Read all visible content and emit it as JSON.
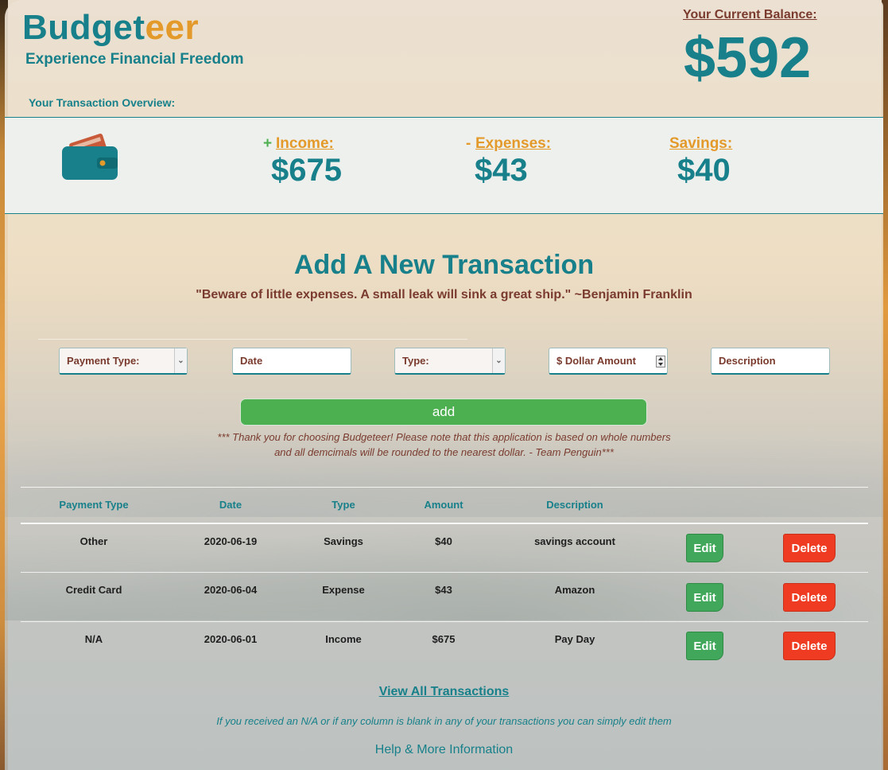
{
  "brand": {
    "name_main": "Budget",
    "name_accent": "eer",
    "tagline": "Experience Financial Freedom"
  },
  "balance": {
    "label": "Your Current Balance:",
    "value": "$592"
  },
  "overview": {
    "label": "Your Transaction Overview:",
    "income": {
      "prefix": "+",
      "label": "Income:",
      "value": "$675"
    },
    "expenses": {
      "prefix": "-",
      "label": "Expenses:",
      "value": "$43"
    },
    "savings": {
      "label": "Savings:",
      "value": "$40"
    }
  },
  "form": {
    "title": "Add A New Transaction",
    "quote": "\"Beware of little expenses. A small leak will sink a great ship.\" ~Benjamin Franklin",
    "payment_type": "Payment Type:",
    "date_placeholder": "Date",
    "type": "Type:",
    "amount_placeholder": "$ Dollar Amount",
    "description_placeholder": "Description",
    "add_label": "add",
    "note_line1": "*** Thank you for choosing Budgeteer! Please note that this application is based on whole numbers",
    "note_line2": "and all demcimals will be rounded to the nearest dollar. - Team Penguin***"
  },
  "table": {
    "headers": [
      "Payment Type",
      "Date",
      "Type",
      "Amount",
      "Description"
    ],
    "edit_label": "Edit",
    "delete_label": "Delete",
    "rows": [
      {
        "payment_type": "Other",
        "date": "2020-06-19",
        "type": "Savings",
        "amount": "$40",
        "description": "savings account"
      },
      {
        "payment_type": "Credit Card",
        "date": "2020-06-04",
        "type": "Expense",
        "amount": "$43",
        "description": "Amazon"
      },
      {
        "payment_type": "N/A",
        "date": "2020-06-01",
        "type": "Income",
        "amount": "$675",
        "description": "Pay Day"
      }
    ]
  },
  "footer": {
    "view_all": "View All Transactions",
    "edit_note": "If you received an N/A or if any column is blank in any of your transactions you can simply edit them",
    "help": "Help & More Information"
  },
  "colors": {
    "teal": "#17808a",
    "orange": "#e49a2a",
    "brown": "#7a3b2e",
    "green": "#4caf50",
    "red": "#ef3b22",
    "income_plus": "#4caf50",
    "expense_minus": "#e49a2a"
  },
  "icons": {
    "wallet": "wallet-icon"
  }
}
